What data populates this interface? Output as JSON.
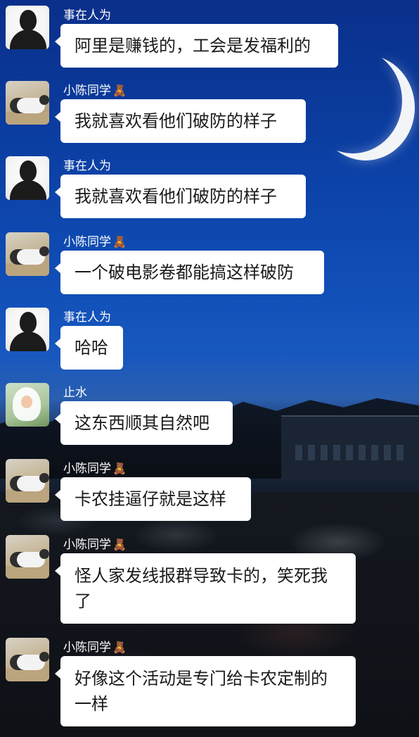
{
  "messages": [
    {
      "sender": "事在人为",
      "emoji": "",
      "text": "阿里是赚钱的，工会是发福利的"
    },
    {
      "sender": "小陈同学",
      "emoji": "🧸",
      "text": "我就喜欢看他们破防的样子"
    },
    {
      "sender": "事在人为",
      "emoji": "",
      "text": "我就喜欢看他们破防的样子"
    },
    {
      "sender": "小陈同学",
      "emoji": "🧸",
      "text": "一个破电影卷都能搞这样破防"
    },
    {
      "sender": "事在人为",
      "emoji": "",
      "text": "哈哈"
    },
    {
      "sender": "止水",
      "emoji": "",
      "text": "这东西顺其自然吧"
    },
    {
      "sender": "小陈同学",
      "emoji": "🧸",
      "text": "卡农挂逼仔就是这样"
    },
    {
      "sender": "小陈同学",
      "emoji": "🧸",
      "text": "怪人家发线报群导致卡的，笑死我了"
    },
    {
      "sender": "小陈同学",
      "emoji": "🧸",
      "text": "好像这个活动是专门给卡农定制的一样"
    }
  ],
  "icons": {
    "shi_avatar": "person-silhouette-avatar",
    "chen_avatar": "cat-photo-avatar",
    "zhi_avatar": "child-photo-avatar",
    "moon": "crescent-moon",
    "name_emoji": "teddy-bear-emoji"
  },
  "colors": {
    "bubble_bg": "#ffffff",
    "text": "#1a1a1a",
    "name_text": "#ffffff",
    "sky_top": "#0a2f8a"
  }
}
